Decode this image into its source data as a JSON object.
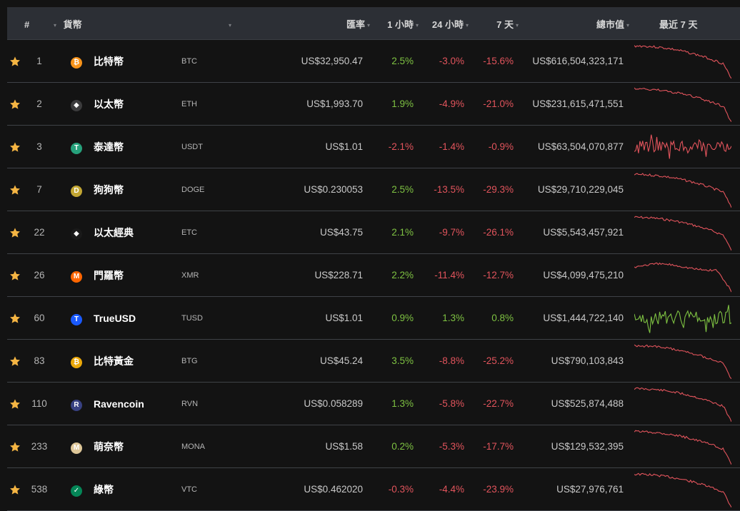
{
  "header": {
    "rank": "#",
    "currency": "貨幣",
    "price": "匯率",
    "h1": "1 小時",
    "h24": "24 小時",
    "d7": "7 天",
    "mcap": "總市值",
    "spark": "最近 7 天"
  },
  "colors": {
    "positive": "#7ec242",
    "negative": "#e2545c",
    "star": "#f5b543"
  },
  "rows": [
    {
      "rank": "1",
      "name": "比特幣",
      "symbol": "BTC",
      "icon": "bitcoin-icon",
      "icon_color": "#f7931a",
      "icon_glyph": "₿",
      "price": "US$32,950.47",
      "h1": "2.5%",
      "h24": "-3.0%",
      "d7": "-15.6%",
      "mcap": "US$616,504,323,171",
      "trend": "down"
    },
    {
      "rank": "2",
      "name": "以太幣",
      "symbol": "ETH",
      "icon": "ethereum-icon",
      "icon_color": "#3c3c3d",
      "icon_glyph": "◆",
      "price": "US$1,993.70",
      "h1": "1.9%",
      "h24": "-4.9%",
      "d7": "-21.0%",
      "mcap": "US$231,615,471,551",
      "trend": "down"
    },
    {
      "rank": "3",
      "name": "泰達幣",
      "symbol": "USDT",
      "icon": "tether-icon",
      "icon_color": "#26a17b",
      "icon_glyph": "T",
      "price": "US$1.01",
      "h1": "-2.1%",
      "h24": "-1.4%",
      "d7": "-0.9%",
      "mcap": "US$63,504,070,877",
      "trend": "flat"
    },
    {
      "rank": "7",
      "name": "狗狗幣",
      "symbol": "DOGE",
      "icon": "dogecoin-icon",
      "icon_color": "#c2a633",
      "icon_glyph": "D",
      "price": "US$0.230053",
      "h1": "2.5%",
      "h24": "-13.5%",
      "d7": "-29.3%",
      "mcap": "US$29,710,229,045",
      "trend": "down"
    },
    {
      "rank": "22",
      "name": "以太經典",
      "symbol": "ETC",
      "icon": "ethereum-classic-icon",
      "icon_color": "#1a1a1a",
      "icon_glyph": "◆",
      "price": "US$43.75",
      "h1": "2.1%",
      "h24": "-9.7%",
      "d7": "-26.1%",
      "mcap": "US$5,543,457,921",
      "trend": "down"
    },
    {
      "rank": "26",
      "name": "門羅幣",
      "symbol": "XMR",
      "icon": "monero-icon",
      "icon_color": "#ff6600",
      "icon_glyph": "M",
      "price": "US$228.71",
      "h1": "2.2%",
      "h24": "-11.4%",
      "d7": "-12.7%",
      "mcap": "US$4,099,475,210",
      "trend": "down2"
    },
    {
      "rank": "60",
      "name": "TrueUSD",
      "symbol": "TUSD",
      "icon": "trueusd-icon",
      "icon_color": "#1a5aff",
      "icon_glyph": "T",
      "price": "US$1.01",
      "h1": "0.9%",
      "h24": "1.3%",
      "d7": "0.8%",
      "mcap": "US$1,444,722,140",
      "trend": "flatup"
    },
    {
      "rank": "83",
      "name": "比特黃金",
      "symbol": "BTG",
      "icon": "bitcoin-gold-icon",
      "icon_color": "#eba809",
      "icon_glyph": "₿",
      "price": "US$45.24",
      "h1": "3.5%",
      "h24": "-8.8%",
      "d7": "-25.2%",
      "mcap": "US$790,103,843",
      "trend": "down"
    },
    {
      "rank": "110",
      "name": "Ravencoin",
      "symbol": "RVN",
      "icon": "ravencoin-icon",
      "icon_color": "#384182",
      "icon_glyph": "R",
      "price": "US$0.058289",
      "h1": "1.3%",
      "h24": "-5.8%",
      "d7": "-22.7%",
      "mcap": "US$525,874,488",
      "trend": "down"
    },
    {
      "rank": "233",
      "name": "萌奈幣",
      "symbol": "MONA",
      "icon": "monacoin-icon",
      "icon_color": "#dec799",
      "icon_glyph": "M",
      "price": "US$1.58",
      "h1": "0.2%",
      "h24": "-5.3%",
      "d7": "-17.7%",
      "mcap": "US$129,532,395",
      "trend": "down"
    },
    {
      "rank": "538",
      "name": "綠幣",
      "symbol": "VTC",
      "icon": "vertcoin-icon",
      "icon_color": "#048657",
      "icon_glyph": "✓",
      "price": "US$0.462020",
      "h1": "-0.3%",
      "h24": "-4.4%",
      "d7": "-23.9%",
      "mcap": "US$27,976,761",
      "trend": "down"
    }
  ]
}
